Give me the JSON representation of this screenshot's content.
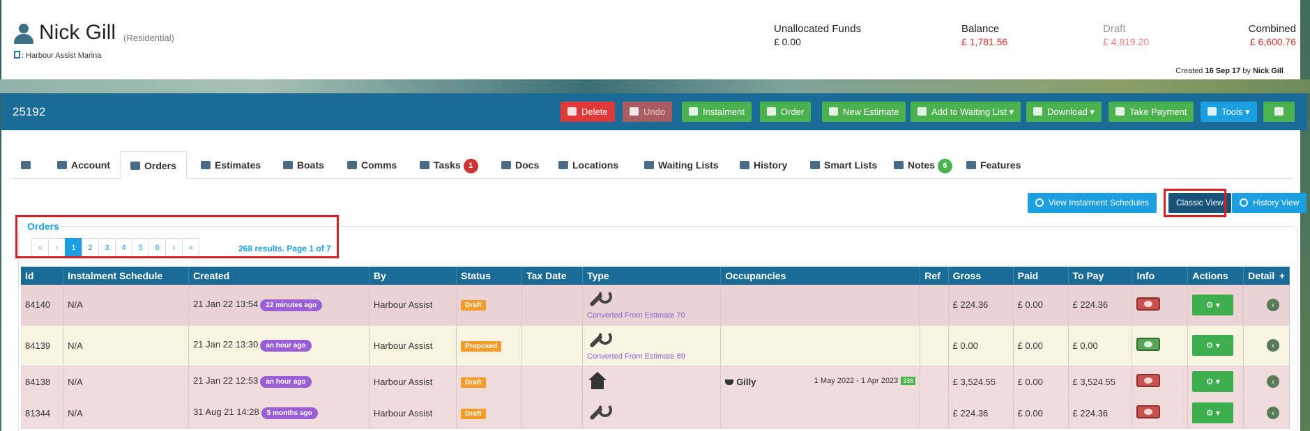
{
  "customer": {
    "name": "Nick Gill",
    "type": "(Residential)",
    "marina": ": Harbour Assist Marina",
    "funds": [
      {
        "label": "Unallocated Funds",
        "value": "£ 0.00"
      },
      {
        "label": "Balance",
        "value": "£ 1,781.56"
      },
      {
        "label": "Draft",
        "value": "£ 4,819.20"
      },
      {
        "label": "Combined",
        "value": "£ 6,600.76"
      }
    ],
    "created_prefix": "Created",
    "created_date": "16 Sep 17",
    "created_by_prefix": "by",
    "created_by": "Nick Gill"
  },
  "toolbar": {
    "account_number": "25192",
    "buttons": {
      "delete": "Delete",
      "undo": "Undo",
      "instalment": "Instalment",
      "order": "Order",
      "new_estimate": "New Estimate",
      "waiting_list": "Add to Waiting List ▾",
      "download": "Download ▾",
      "take_payment": "Take Payment",
      "tools": "Tools ▾"
    }
  },
  "tabs": {
    "account": "Account",
    "orders": "Orders",
    "estimates": "Estimates",
    "boats": "Boats",
    "comms": "Comms",
    "tasks": "Tasks",
    "tasks_badge": "1",
    "docs": "Docs",
    "locations": "Locations",
    "waiting_lists": "Waiting Lists",
    "history": "History",
    "smart_lists": "Smart Lists",
    "notes": "Notes",
    "notes_badge": "6",
    "features": "Features"
  },
  "views": {
    "instalment_schedules": "View Instalment Schedules",
    "classic": "Classic View",
    "history": "History View"
  },
  "orders": {
    "title": "Orders",
    "pager": [
      "«",
      "‹",
      "1",
      "2",
      "3",
      "4",
      "5",
      "6",
      "›",
      "»"
    ],
    "results": "268 results. Page 1 of 7",
    "columns": {
      "id": "Id",
      "schedule": "Instalment Schedule",
      "created": "Created",
      "by": "By",
      "status": "Status",
      "tax_date": "Tax Date",
      "type": "Type",
      "occupancies": "Occupancies",
      "ref": "Ref",
      "gross": "Gross",
      "paid": "Paid",
      "to_pay": "To Pay",
      "info": "Info",
      "actions": "Actions",
      "detail": "Detail",
      "add": "+"
    },
    "rows": [
      {
        "id": "84140",
        "schedule": "N/A",
        "created": "21 Jan 22 13:54",
        "age": "22 minutes ago",
        "by": "Harbour Assist",
        "status": "Draft",
        "converted": "Converted From Estimate 70",
        "gross": "£ 224.36",
        "paid": "£ 0.00",
        "to_pay": "£ 224.36"
      },
      {
        "id": "84139",
        "schedule": "N/A",
        "created": "21 Jan 22 13:30",
        "age": "an hour ago",
        "by": "Harbour Assist",
        "status": "Proposed",
        "converted": "Converted From Estimate 69",
        "gross": "£ 0.00",
        "paid": "£ 0.00",
        "to_pay": "£ 0.00"
      },
      {
        "id": "84138",
        "schedule": "N/A",
        "created": "21 Jan 22 12:53",
        "age": "an hour ago",
        "by": "Harbour Assist",
        "status": "Draft",
        "boat": "Gilly",
        "dates": "1 May 2022 - 1 Apr 2023",
        "days": "335",
        "gross": "£ 3,524.55",
        "paid": "£ 0.00",
        "to_pay": "£ 3,524.55"
      },
      {
        "id": "81344",
        "schedule": "N/A",
        "created": "31 Aug 21 14:28",
        "age": "5 months ago",
        "by": "Harbour Assist",
        "status": "Draft",
        "gross": "£ 224.36",
        "paid": "£ 0.00",
        "to_pay": "£ 224.36"
      }
    ],
    "action_label": "⚙ ▾",
    "detail_label": "‹"
  }
}
